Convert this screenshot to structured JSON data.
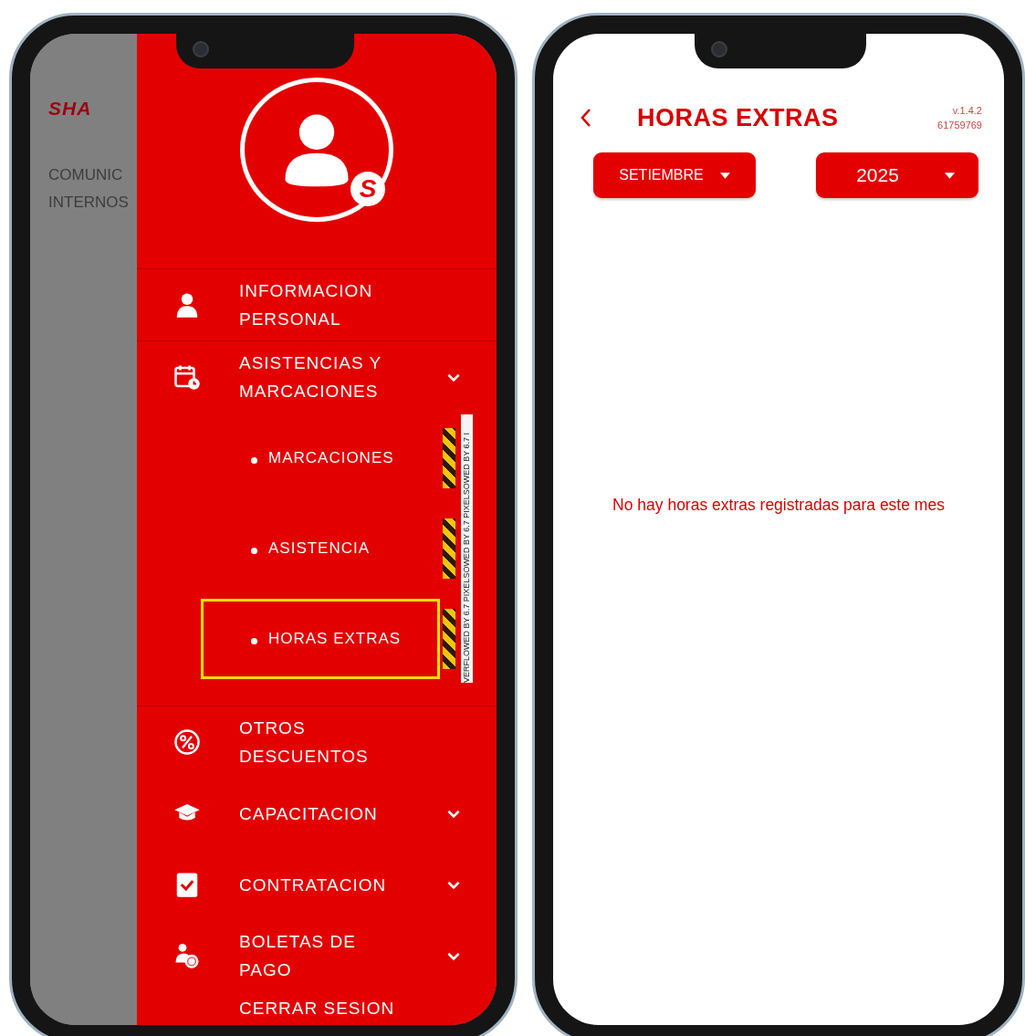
{
  "left_phone": {
    "background_app": {
      "logo": "SHA",
      "menu_label": "COMUNIC\nINTERNOS"
    },
    "drawer": {
      "avatar_badge": "S",
      "items": [
        {
          "kind": "link",
          "label": "INFORMACION\nPERSONAL"
        },
        {
          "kind": "expandable",
          "label": "ASISTENCIAS Y\nMARCACIONES",
          "expanded": true,
          "overflow_warning": "VERFLOWED BY 6.7 PIXELSOWED BY 6.7 PIXELSOWED BY 6.7 I",
          "children": [
            {
              "label": "MARCACIONES",
              "selected": false
            },
            {
              "label": "ASISTENCIA",
              "selected": false
            },
            {
              "label": "HORAS EXTRAS",
              "selected": true
            }
          ]
        },
        {
          "kind": "link",
          "label": "OTROS\nDESCUENTOS"
        },
        {
          "kind": "expandable",
          "label": "CAPACITACION"
        },
        {
          "kind": "expandable",
          "label": "CONTRATACION"
        },
        {
          "kind": "expandable",
          "label": "BOLETAS DE\nPAGO"
        }
      ],
      "logout": "CERRAR SESION"
    }
  },
  "right_phone": {
    "header": {
      "title": "HORAS EXTRAS",
      "version": "v.1.4.2",
      "user_code": "61759769"
    },
    "filters": [
      {
        "value": "SETIEMBRE"
      },
      {
        "value": "2025"
      }
    ],
    "empty_message": "No hay horas extras registradas para este mes"
  }
}
